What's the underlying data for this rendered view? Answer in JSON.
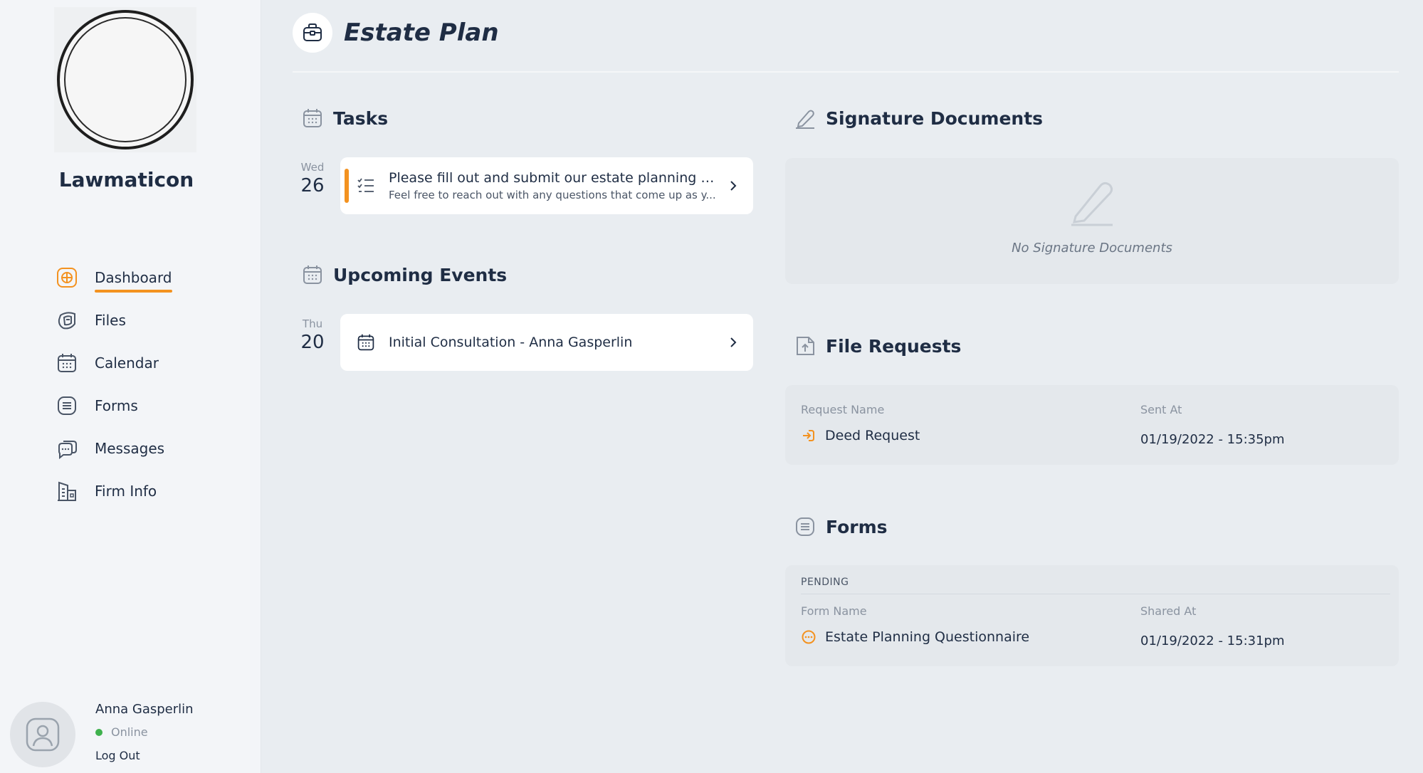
{
  "firm": {
    "name": "Lawmaticon"
  },
  "nav": {
    "items": [
      {
        "label": "Dashboard",
        "icon": "dashboard-icon",
        "active": true
      },
      {
        "label": "Files",
        "icon": "files-icon"
      },
      {
        "label": "Calendar",
        "icon": "calendar-icon"
      },
      {
        "label": "Forms",
        "icon": "forms-icon"
      },
      {
        "label": "Messages",
        "icon": "messages-icon"
      },
      {
        "label": "Firm Info",
        "icon": "building-icon"
      }
    ]
  },
  "user": {
    "name": "Anna Gasperlin",
    "status": "Online",
    "logout_label": "Log Out"
  },
  "page": {
    "title": "Estate Plan",
    "icon": "briefcase-icon"
  },
  "tasks": {
    "title": "Tasks",
    "items": [
      {
        "dow": "Wed",
        "day": "26",
        "title": "Please fill out and submit our estate planning q...",
        "subtitle": "Feel free to reach out with any questions that come up as y..."
      }
    ]
  },
  "events": {
    "title": "Upcoming Events",
    "items": [
      {
        "dow": "Thu",
        "day": "20",
        "title": "Initial Consultation - Anna Gasperlin"
      }
    ]
  },
  "signature_documents": {
    "title": "Signature Documents",
    "empty_text": "No Signature Documents"
  },
  "file_requests": {
    "title": "File Requests",
    "columns": [
      "Request Name",
      "Sent At"
    ],
    "rows": [
      {
        "name": "Deed Request",
        "sent_at": "01/19/2022 - 15:35pm"
      }
    ]
  },
  "forms": {
    "title": "Forms",
    "group_label": "PENDING",
    "columns": [
      "Form Name",
      "Shared At"
    ],
    "rows": [
      {
        "name": "Estate Planning Questionnaire",
        "shared_at": "01/19/2022 - 15:31pm"
      }
    ]
  },
  "colors": {
    "accent": "#f39220",
    "online": "#3fb14d",
    "text": "#1f2d44",
    "background": "#e9edf1"
  }
}
